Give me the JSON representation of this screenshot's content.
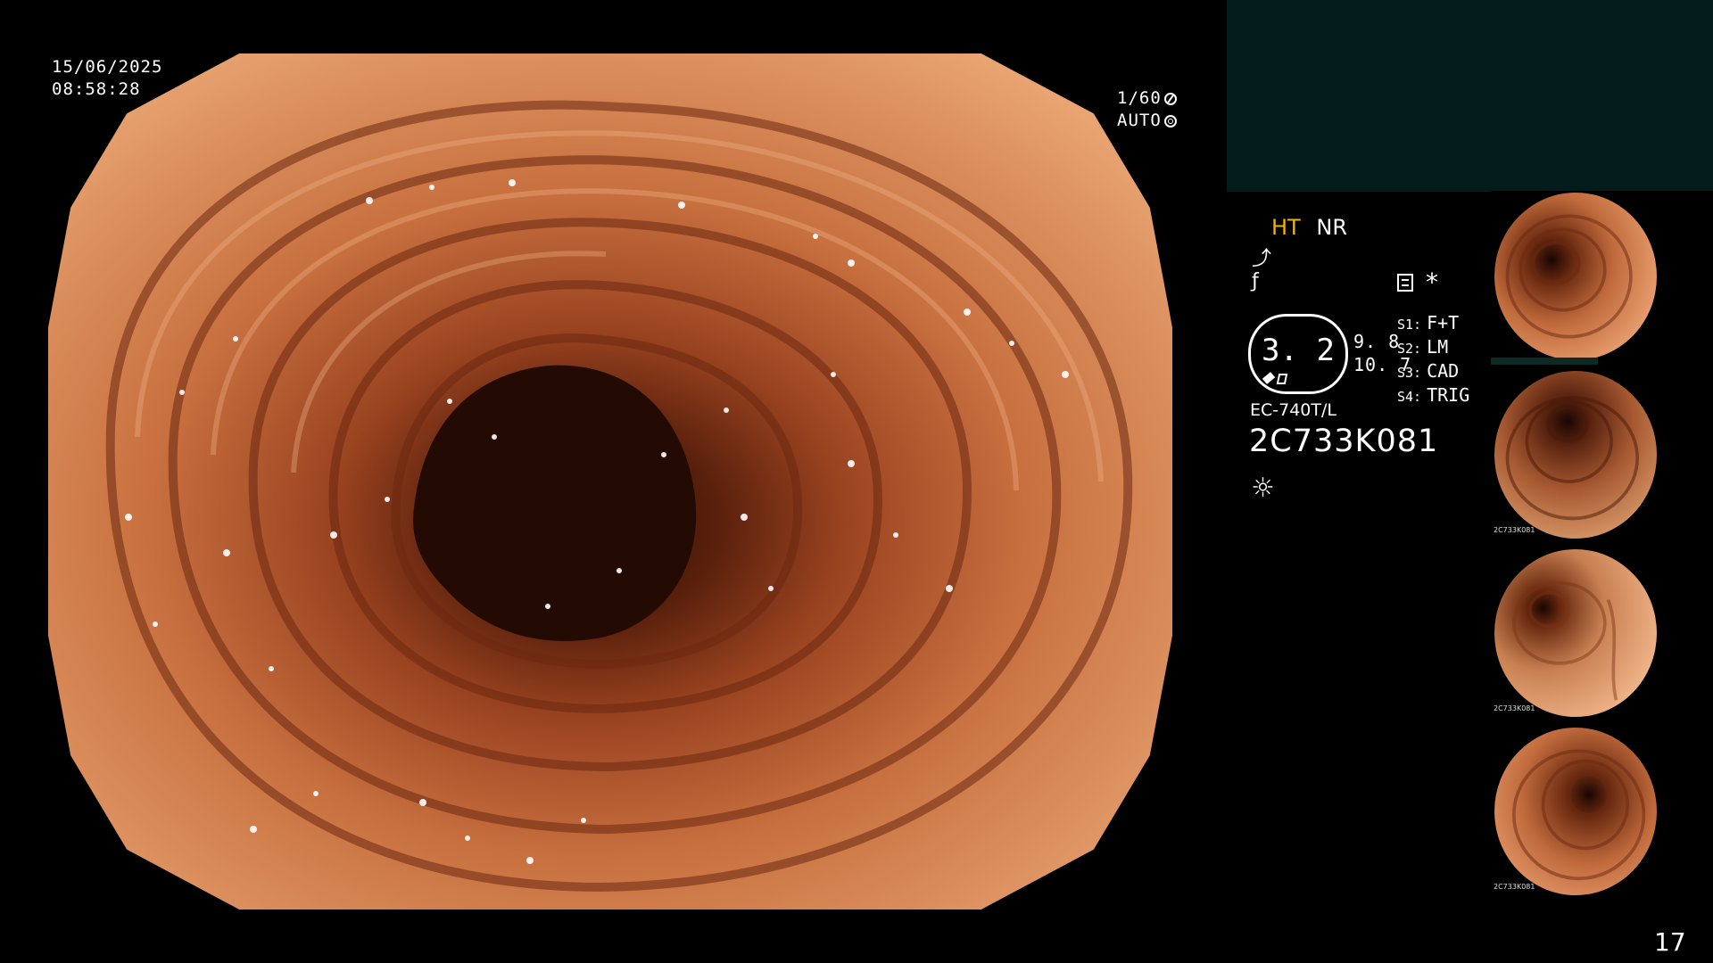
{
  "overlay": {
    "date": "15/06/2025",
    "time": "08:58:28",
    "shutter": "1/60",
    "iris": "AUTO"
  },
  "panel": {
    "mode_ht": "HT",
    "mode_nr": "NR",
    "zoom_value": "3. 2",
    "zoom_min": "9. 8",
    "zoom_max": "10. 7",
    "settings": [
      {
        "key": "S1:",
        "value": "F+T"
      },
      {
        "key": "S2:",
        "value": "LM"
      },
      {
        "key": "S3:",
        "value": "CAD"
      },
      {
        "key": "S4:",
        "value": "TRIG"
      }
    ],
    "scope_model": "EC-740T/L",
    "serial": "2C733K081"
  },
  "thumbnails": [
    {
      "serial": "2C733K081"
    },
    {
      "serial": "2C733K081"
    },
    {
      "serial": "2C733K081"
    },
    {
      "serial": "2C733K081"
    }
  ],
  "page_number": "17",
  "colors": {
    "tissue_light": "#e39a6a",
    "tissue_dark": "#5a200c",
    "lumen": "#2a0d04",
    "ht_accent": "#f2b400",
    "panel_teal": "#021c1c"
  },
  "icons": {
    "shutter": "shutter-icon",
    "iris": "iris-icon",
    "enhance": "enhance-icon",
    "light": "light-source-icon"
  }
}
